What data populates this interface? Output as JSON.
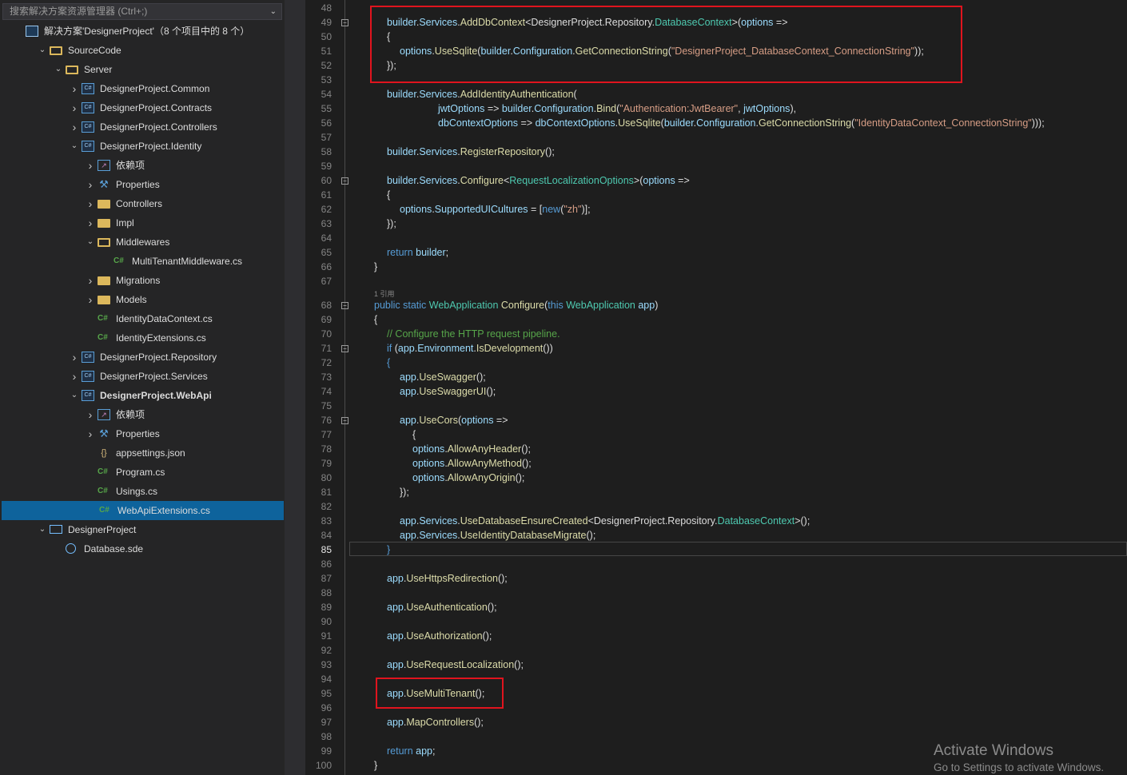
{
  "explorer": {
    "search_placeholder": "搜索解决方案资源管理器 (Ctrl+;)",
    "solution_label": "解决方案'DesignerProject'（8 个项目中的 8 个）",
    "items": [
      {
        "label": "SourceCode"
      },
      {
        "label": "Server"
      },
      {
        "label": "DesignerProject.Common"
      },
      {
        "label": "DesignerProject.Contracts"
      },
      {
        "label": "DesignerProject.Controllers"
      },
      {
        "label": "DesignerProject.Identity"
      },
      {
        "label": "依赖项"
      },
      {
        "label": "Properties"
      },
      {
        "label": "Controllers"
      },
      {
        "label": "Impl"
      },
      {
        "label": "Middlewares"
      },
      {
        "label": "MultiTenantMiddleware.cs"
      },
      {
        "label": "Migrations"
      },
      {
        "label": "Models"
      },
      {
        "label": "IdentityDataContext.cs"
      },
      {
        "label": "IdentityExtensions.cs"
      },
      {
        "label": "DesignerProject.Repository"
      },
      {
        "label": "DesignerProject.Services"
      },
      {
        "label": "DesignerProject.WebApi"
      },
      {
        "label": "依赖项"
      },
      {
        "label": "Properties"
      },
      {
        "label": "appsettings.json"
      },
      {
        "label": "Program.cs"
      },
      {
        "label": "Usings.cs"
      },
      {
        "label": "WebApiExtensions.cs"
      },
      {
        "label": "DesignerProject"
      },
      {
        "label": "Database.sde"
      }
    ],
    "selected_item": "WebApiExtensions.cs"
  },
  "editor": {
    "current_line": 85,
    "reference_hint": "1 引用",
    "lines": [
      {
        "n": "48",
        "tokens": []
      },
      {
        "n": "49",
        "tokens": [
          [
            "id",
            "builder"
          ],
          [
            "pl",
            "."
          ],
          [
            "id",
            "Services"
          ],
          [
            "pl",
            "."
          ],
          [
            "fn",
            "AddDbContext"
          ],
          [
            "pl",
            "<DesignerProject.Repository."
          ],
          [
            "ty",
            "DatabaseContext"
          ],
          [
            "pl",
            ">("
          ],
          [
            "id",
            "options"
          ],
          [
            "pl",
            " =>"
          ]
        ]
      },
      {
        "n": "50",
        "tokens": [
          [
            "pl",
            "{"
          ]
        ]
      },
      {
        "n": "51",
        "tokens": [
          [
            "id",
            "options"
          ],
          [
            "pl",
            "."
          ],
          [
            "fn",
            "UseSqlite"
          ],
          [
            "pl",
            "("
          ],
          [
            "id",
            "builder"
          ],
          [
            "pl",
            "."
          ],
          [
            "id",
            "Configuration"
          ],
          [
            "pl",
            "."
          ],
          [
            "fn",
            "GetConnectionString"
          ],
          [
            "pl",
            "("
          ],
          [
            "st",
            "\"DesignerProject_DatabaseContext_ConnectionString\""
          ],
          [
            "pl",
            "));"
          ]
        ]
      },
      {
        "n": "52",
        "tokens": [
          [
            "pl",
            "});"
          ]
        ]
      },
      {
        "n": "53",
        "tokens": []
      },
      {
        "n": "54",
        "tokens": [
          [
            "id",
            "builder"
          ],
          [
            "pl",
            "."
          ],
          [
            "id",
            "Services"
          ],
          [
            "pl",
            "."
          ],
          [
            "fn",
            "AddIdentityAuthentication"
          ],
          [
            "pl",
            "("
          ]
        ]
      },
      {
        "n": "55",
        "tokens": [
          [
            "id",
            "jwtOptions"
          ],
          [
            "pl",
            " => "
          ],
          [
            "id",
            "builder"
          ],
          [
            "pl",
            "."
          ],
          [
            "id",
            "Configuration"
          ],
          [
            "pl",
            "."
          ],
          [
            "fn",
            "Bind"
          ],
          [
            "pl",
            "("
          ],
          [
            "st",
            "\"Authentication:JwtBearer\""
          ],
          [
            "pl",
            ", "
          ],
          [
            "id",
            "jwtOptions"
          ],
          [
            "pl",
            "),"
          ]
        ]
      },
      {
        "n": "56",
        "tokens": [
          [
            "id",
            "dbContextOptions"
          ],
          [
            "pl",
            " => "
          ],
          [
            "id",
            "dbContextOptions"
          ],
          [
            "pl",
            "."
          ],
          [
            "fn",
            "UseSqlite"
          ],
          [
            "pl",
            "("
          ],
          [
            "id",
            "builder"
          ],
          [
            "pl",
            "."
          ],
          [
            "id",
            "Configuration"
          ],
          [
            "pl",
            "."
          ],
          [
            "fn",
            "GetConnectionString"
          ],
          [
            "pl",
            "("
          ],
          [
            "st",
            "\"IdentityDataContext_ConnectionString\""
          ],
          [
            "pl",
            ")));"
          ]
        ]
      },
      {
        "n": "57",
        "tokens": []
      },
      {
        "n": "58",
        "tokens": [
          [
            "id",
            "builder"
          ],
          [
            "pl",
            "."
          ],
          [
            "id",
            "Services"
          ],
          [
            "pl",
            "."
          ],
          [
            "fn",
            "RegisterRepository"
          ],
          [
            "pl",
            "();"
          ]
        ]
      },
      {
        "n": "59",
        "tokens": []
      },
      {
        "n": "60",
        "tokens": [
          [
            "id",
            "builder"
          ],
          [
            "pl",
            "."
          ],
          [
            "id",
            "Services"
          ],
          [
            "pl",
            "."
          ],
          [
            "fn",
            "Configure"
          ],
          [
            "pl",
            "<"
          ],
          [
            "ty",
            "RequestLocalizationOptions"
          ],
          [
            "pl",
            ">("
          ],
          [
            "id",
            "options"
          ],
          [
            "pl",
            " =>"
          ]
        ]
      },
      {
        "n": "61",
        "tokens": [
          [
            "pl",
            "{"
          ]
        ]
      },
      {
        "n": "62",
        "tokens": [
          [
            "id",
            "options"
          ],
          [
            "pl",
            "."
          ],
          [
            "id",
            "SupportedUICultures"
          ],
          [
            "pl",
            " = ["
          ],
          [
            "kw",
            "new"
          ],
          [
            "pl",
            "("
          ],
          [
            "st",
            "\"zh\""
          ],
          [
            "pl",
            ")];"
          ]
        ]
      },
      {
        "n": "63",
        "tokens": [
          [
            "pl",
            "});"
          ]
        ]
      },
      {
        "n": "64",
        "tokens": []
      },
      {
        "n": "65",
        "tokens": [
          [
            "kw",
            "return"
          ],
          [
            "pl",
            " "
          ],
          [
            "id",
            "builder"
          ],
          [
            "pl",
            ";"
          ]
        ]
      },
      {
        "n": "66",
        "tokens": [
          [
            "pl",
            "}"
          ]
        ]
      },
      {
        "n": "67",
        "tokens": []
      },
      {
        "n": "68",
        "tokens": [
          [
            "kw",
            "public static "
          ],
          [
            "ty",
            "WebApplication"
          ],
          [
            "pl",
            " "
          ],
          [
            "fn",
            "Configure"
          ],
          [
            "pl",
            "("
          ],
          [
            "kw",
            "this "
          ],
          [
            "ty",
            "WebApplication"
          ],
          [
            "pl",
            " "
          ],
          [
            "id",
            "app"
          ],
          [
            "pl",
            ")"
          ]
        ]
      },
      {
        "n": "69",
        "tokens": [
          [
            "pl",
            "{"
          ]
        ]
      },
      {
        "n": "70",
        "tokens": [
          [
            "cm",
            "// Configure the HTTP request pipeline."
          ]
        ]
      },
      {
        "n": "71",
        "tokens": [
          [
            "kw",
            "if"
          ],
          [
            "pl",
            " ("
          ],
          [
            "id",
            "app"
          ],
          [
            "pl",
            "."
          ],
          [
            "id",
            "Environment"
          ],
          [
            "pl",
            "."
          ],
          [
            "fn",
            "IsDevelopment"
          ],
          [
            "pl",
            "())"
          ]
        ]
      },
      {
        "n": "72",
        "tokens": [
          [
            "kw",
            "{"
          ]
        ]
      },
      {
        "n": "73",
        "tokens": [
          [
            "id",
            "app"
          ],
          [
            "pl",
            "."
          ],
          [
            "fn",
            "UseSwagger"
          ],
          [
            "pl",
            "();"
          ]
        ]
      },
      {
        "n": "74",
        "tokens": [
          [
            "id",
            "app"
          ],
          [
            "pl",
            "."
          ],
          [
            "fn",
            "UseSwaggerUI"
          ],
          [
            "pl",
            "();"
          ]
        ]
      },
      {
        "n": "75",
        "tokens": []
      },
      {
        "n": "76",
        "tokens": [
          [
            "id",
            "app"
          ],
          [
            "pl",
            "."
          ],
          [
            "fn",
            "UseCors"
          ],
          [
            "pl",
            "("
          ],
          [
            "id",
            "options"
          ],
          [
            "pl",
            " =>"
          ]
        ]
      },
      {
        "n": "77",
        "tokens": [
          [
            "pl",
            "{"
          ]
        ]
      },
      {
        "n": "78",
        "tokens": [
          [
            "id",
            "options"
          ],
          [
            "pl",
            "."
          ],
          [
            "fn",
            "AllowAnyHeader"
          ],
          [
            "pl",
            "();"
          ]
        ]
      },
      {
        "n": "79",
        "tokens": [
          [
            "id",
            "options"
          ],
          [
            "pl",
            "."
          ],
          [
            "fn",
            "AllowAnyMethod"
          ],
          [
            "pl",
            "();"
          ]
        ]
      },
      {
        "n": "80",
        "tokens": [
          [
            "id",
            "options"
          ],
          [
            "pl",
            "."
          ],
          [
            "fn",
            "AllowAnyOrigin"
          ],
          [
            "pl",
            "();"
          ]
        ]
      },
      {
        "n": "81",
        "tokens": [
          [
            "pl",
            "});"
          ]
        ]
      },
      {
        "n": "82",
        "tokens": []
      },
      {
        "n": "83",
        "tokens": [
          [
            "id",
            "app"
          ],
          [
            "pl",
            "."
          ],
          [
            "id",
            "Services"
          ],
          [
            "pl",
            "."
          ],
          [
            "fn",
            "UseDatabaseEnsureCreated"
          ],
          [
            "pl",
            "<DesignerProject.Repository."
          ],
          [
            "ty",
            "DatabaseContext"
          ],
          [
            "pl",
            ">();"
          ]
        ]
      },
      {
        "n": "84",
        "tokens": [
          [
            "id",
            "app"
          ],
          [
            "pl",
            "."
          ],
          [
            "id",
            "Services"
          ],
          [
            "pl",
            "."
          ],
          [
            "fn",
            "UseIdentityDatabaseMigrate"
          ],
          [
            "pl",
            "();"
          ]
        ]
      },
      {
        "n": "85",
        "tokens": [
          [
            "kw",
            "}"
          ]
        ]
      },
      {
        "n": "86",
        "tokens": []
      },
      {
        "n": "87",
        "tokens": [
          [
            "id",
            "app"
          ],
          [
            "pl",
            "."
          ],
          [
            "fn",
            "UseHttpsRedirection"
          ],
          [
            "pl",
            "();"
          ]
        ]
      },
      {
        "n": "88",
        "tokens": []
      },
      {
        "n": "89",
        "tokens": [
          [
            "id",
            "app"
          ],
          [
            "pl",
            "."
          ],
          [
            "fn",
            "UseAuthentication"
          ],
          [
            "pl",
            "();"
          ]
        ]
      },
      {
        "n": "90",
        "tokens": []
      },
      {
        "n": "91",
        "tokens": [
          [
            "id",
            "app"
          ],
          [
            "pl",
            "."
          ],
          [
            "fn",
            "UseAuthorization"
          ],
          [
            "pl",
            "();"
          ]
        ]
      },
      {
        "n": "92",
        "tokens": []
      },
      {
        "n": "93",
        "tokens": [
          [
            "id",
            "app"
          ],
          [
            "pl",
            "."
          ],
          [
            "fn",
            "UseRequestLocalization"
          ],
          [
            "pl",
            "();"
          ]
        ]
      },
      {
        "n": "94",
        "tokens": []
      },
      {
        "n": "95",
        "tokens": [
          [
            "id",
            "app"
          ],
          [
            "pl",
            "."
          ],
          [
            "fn",
            "UseMultiTenant"
          ],
          [
            "pl",
            "();"
          ]
        ]
      },
      {
        "n": "96",
        "tokens": []
      },
      {
        "n": "97",
        "tokens": [
          [
            "id",
            "app"
          ],
          [
            "pl",
            "."
          ],
          [
            "fn",
            "MapControllers"
          ],
          [
            "pl",
            "();"
          ]
        ]
      },
      {
        "n": "98",
        "tokens": []
      },
      {
        "n": "99",
        "tokens": [
          [
            "kw",
            "return"
          ],
          [
            "pl",
            " "
          ],
          [
            "id",
            "app"
          ],
          [
            "pl",
            ";"
          ]
        ]
      },
      {
        "n": "100",
        "tokens": [
          [
            "pl",
            "}"
          ]
        ]
      }
    ]
  },
  "watermark": {
    "title": "Activate Windows",
    "subtitle": "Go to Settings to activate Windows."
  },
  "colors": {
    "highlight_box": "#e0141e",
    "selection": "#0e639c"
  }
}
